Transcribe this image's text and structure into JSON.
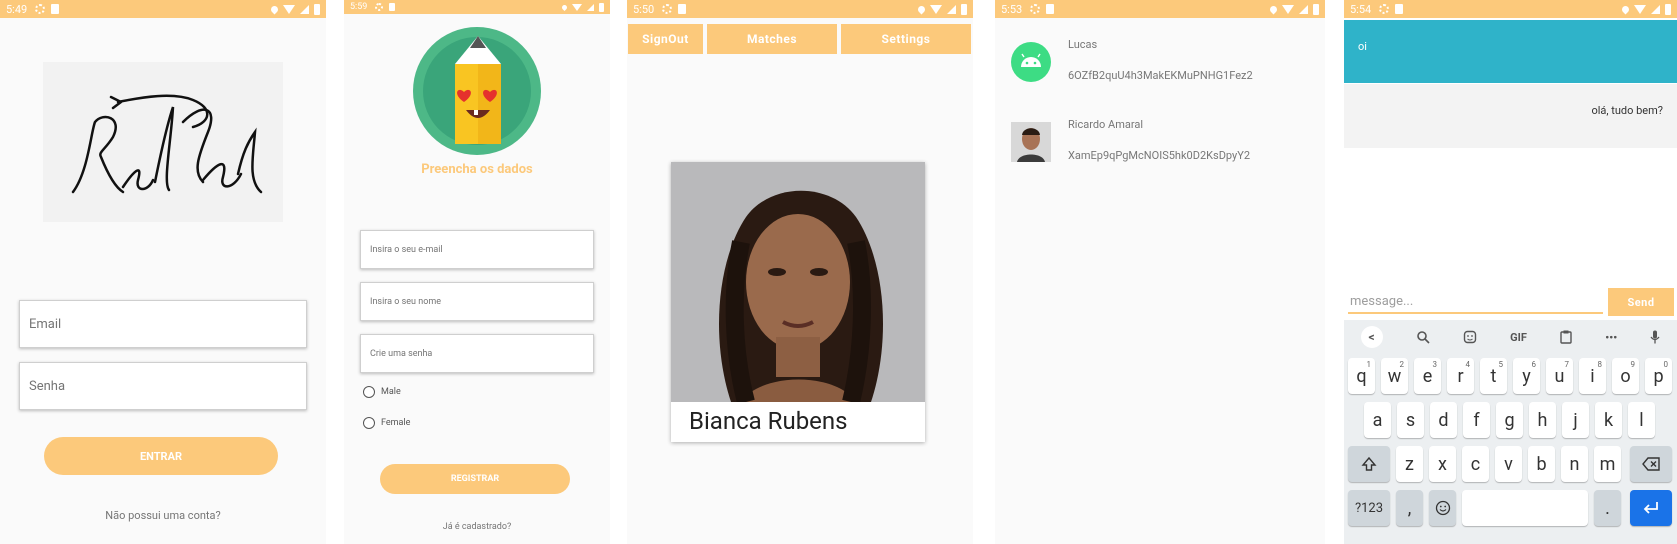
{
  "colors": {
    "accent": "#fcc97b",
    "chat_sent": "#2fb3c9",
    "enter_key": "#1a73e8"
  },
  "screens": {
    "login": {
      "time": "5:49",
      "email_placeholder": "Email",
      "password_placeholder": "Senha",
      "enter_label": "ENTRAR",
      "signup_link": "Não possui uma conta?"
    },
    "register": {
      "time": "5:59",
      "title": "Preencha os dados",
      "email_placeholder": "Insira o seu e-mail",
      "name_placeholder": "Insira o seu nome",
      "password_placeholder": "Crie uma senha",
      "gender_options": [
        "Male",
        "Female"
      ],
      "register_label": "REGISTRAR",
      "login_link": "Já é cadastrado?"
    },
    "swipe": {
      "time": "5:50",
      "nav": [
        "SignOut",
        "Matches",
        "Settings"
      ],
      "card_name": "Bianca Rubens"
    },
    "matches": {
      "time": "5:53",
      "items": [
        {
          "name": "Lucas",
          "id": "6OZfB2quU4h3MakEKMuPNHG1Fez2",
          "avatar": "android-icon"
        },
        {
          "name": "Ricardo Amaral",
          "id": "XamEp9qPgMcNOIS5hk0D2KsDpyY2",
          "avatar": "user-photo"
        }
      ]
    },
    "chat": {
      "time": "5:54",
      "messages": [
        {
          "text": "oi",
          "side": "sent"
        },
        {
          "text": "olá, tudo bem?",
          "side": "received"
        }
      ],
      "input_placeholder": "message...",
      "send_label": "Send",
      "keyboard": {
        "toolbar": [
          "<",
          "search-icon",
          "sticker-icon",
          "GIF",
          "clipboard-icon",
          "•••",
          "mic-icon"
        ],
        "row1": [
          "q",
          "w",
          "e",
          "r",
          "t",
          "y",
          "u",
          "i",
          "o",
          "p"
        ],
        "row1_hints": [
          "1",
          "2",
          "3",
          "4",
          "5",
          "6",
          "7",
          "8",
          "9",
          "0"
        ],
        "row2": [
          "a",
          "s",
          "d",
          "f",
          "g",
          "h",
          "j",
          "k",
          "l"
        ],
        "row3": [
          "z",
          "x",
          "c",
          "v",
          "b",
          "n",
          "m"
        ],
        "symbols_label": "?123",
        "comma": ",",
        "period": "."
      }
    }
  }
}
